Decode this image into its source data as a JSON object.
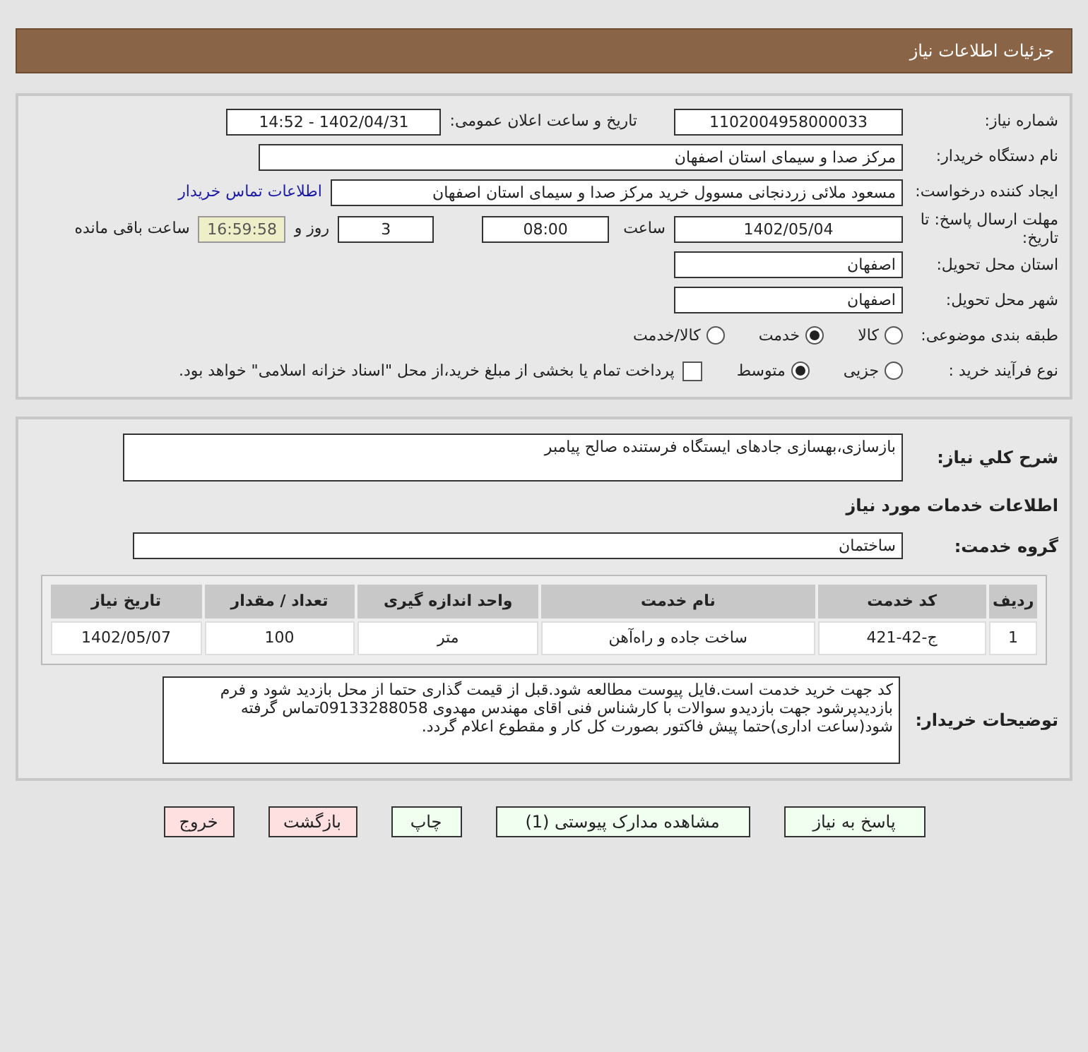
{
  "title": "جزئیات اطلاعات نیاز",
  "need_number": {
    "label": "شماره نیاز:",
    "value": "1102004958000033"
  },
  "announce": {
    "label": "تاریخ و ساعت اعلان عمومی:",
    "value": "1402/04/31 - 14:52"
  },
  "buyer_org": {
    "label": "نام دستگاه خریدار:",
    "value": "مرکز صدا و سیمای استان اصفهان"
  },
  "requester": {
    "label": "ایجاد کننده درخواست:",
    "value": "مسعود ملائی زردنجانی مسوول خرید مرکز صدا و سیمای استان اصفهان",
    "link": "اطلاعات تماس خریدار"
  },
  "deadline": {
    "label": "مهلت ارسال پاسخ: تا تاریخ:",
    "date": "1402/05/04",
    "time_label": "ساعت",
    "time": "08:00",
    "days": "3",
    "days_label": "روز و",
    "remaining": "16:59:58",
    "remaining_label": "ساعت باقی مانده"
  },
  "province": {
    "label": "استان محل تحویل:",
    "value": "اصفهان"
  },
  "city": {
    "label": "شهر محل تحویل:",
    "value": "اصفهان"
  },
  "category": {
    "label": "طبقه بندی موضوعی:",
    "options": [
      {
        "label": "کالا",
        "selected": false
      },
      {
        "label": "خدمت",
        "selected": true
      },
      {
        "label": "کالا/خدمت",
        "selected": false
      }
    ]
  },
  "process": {
    "label": "نوع فرآیند خرید :",
    "options": [
      {
        "label": "جزیی",
        "selected": false
      },
      {
        "label": "متوسط",
        "selected": true
      }
    ],
    "checkbox": {
      "checked": false,
      "label": "پرداخت تمام یا بخشی از مبلغ خرید،از محل \"اسناد خزانه اسلامی\" خواهد بود."
    }
  },
  "description": {
    "label": "شرح کلي نياز:",
    "value": "بازسازی،بهسازی جادهای ایستگاه فرستنده صالح پیامبر"
  },
  "services_heading": "اطلاعات خدمات مورد نیاز",
  "service_group": {
    "label": "گروه خدمت:",
    "value": "ساختمان"
  },
  "table": {
    "columns": [
      "ردیف",
      "کد خدمت",
      "نام خدمت",
      "واحد اندازه گیری",
      "تعداد / مقدار",
      "تاریخ نیاز"
    ],
    "rows": [
      [
        "1",
        "ج-42-421",
        "ساخت جاده و راه‌آهن",
        "متر",
        "100",
        "1402/05/07"
      ]
    ]
  },
  "buyer_notes": {
    "label": "توضیحات خریدار:",
    "value": "کد جهت خرید خدمت است.فایل پیوست مطالعه شود.قبل از قیمت گذاری حتما از محل بازدید شود و فرم بازدیدپرشود جهت بازدیدو سوالات با کارشناس فنی اقای مهندس مهدوی 09133288058تماس گرفته شود(ساعت اداری)حتما پیش فاکتور بصورت کل کار و مقطوع اعلام گردد."
  },
  "buttons": [
    {
      "label": "پاسخ به نیاز",
      "color": "#f0fff0"
    },
    {
      "label": "مشاهده مدارک پیوستی (1)",
      "color": "#f0fff0"
    },
    {
      "label": "چاپ",
      "color": "#f0fff0"
    },
    {
      "label": "بازگشت",
      "color": "#ffe0e0"
    },
    {
      "label": "خروج",
      "color": "#ffe0e0"
    }
  ]
}
